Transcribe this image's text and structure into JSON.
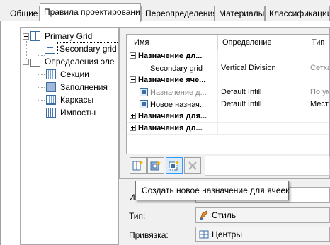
{
  "tabs": [
    {
      "label": "Общие"
    },
    {
      "label": "Правила проектирования"
    },
    {
      "label": "Переопределения"
    },
    {
      "label": "Материалы"
    },
    {
      "label": "Классификации"
    }
  ],
  "tree": {
    "primary_grid": "Primary Grid",
    "secondary_grid": "Secondary grid",
    "element_definitions": "Определения эле",
    "sections": "Секции",
    "infills": "Заполнения",
    "frames": "Каркасы",
    "mullions": "Импосты"
  },
  "grid": {
    "columns": [
      "Имя",
      "Определение",
      "Тип"
    ],
    "rows": [
      {
        "name": "Назначение дл...",
        "definition": "",
        "type": ""
      },
      {
        "name": "Secondary grid",
        "definition": "Vertical Division",
        "type": "Сетка"
      },
      {
        "name": "Назначение яче...",
        "definition": "",
        "type": ""
      },
      {
        "name": "Назначение д...",
        "definition": "Default Infill",
        "type": "По ум"
      },
      {
        "name": "Новое назнач...",
        "definition": "Default Infill",
        "type": "Мест"
      },
      {
        "name": "Назначения для...",
        "definition": "",
        "type": ""
      },
      {
        "name": "Назначения дл...",
        "definition": "",
        "type": ""
      }
    ]
  },
  "props": {
    "name_label": "Им",
    "type_label": "Тип:",
    "type_value": "Стиль",
    "binding_label": "Привязка:",
    "binding_value": "Центры"
  },
  "tooltip": "Создать новое назначение для ячеек",
  "colors": {
    "accent": "#3a6ea5",
    "hot_border": "#3399ff",
    "hot_fill": "#d8ecfc"
  }
}
